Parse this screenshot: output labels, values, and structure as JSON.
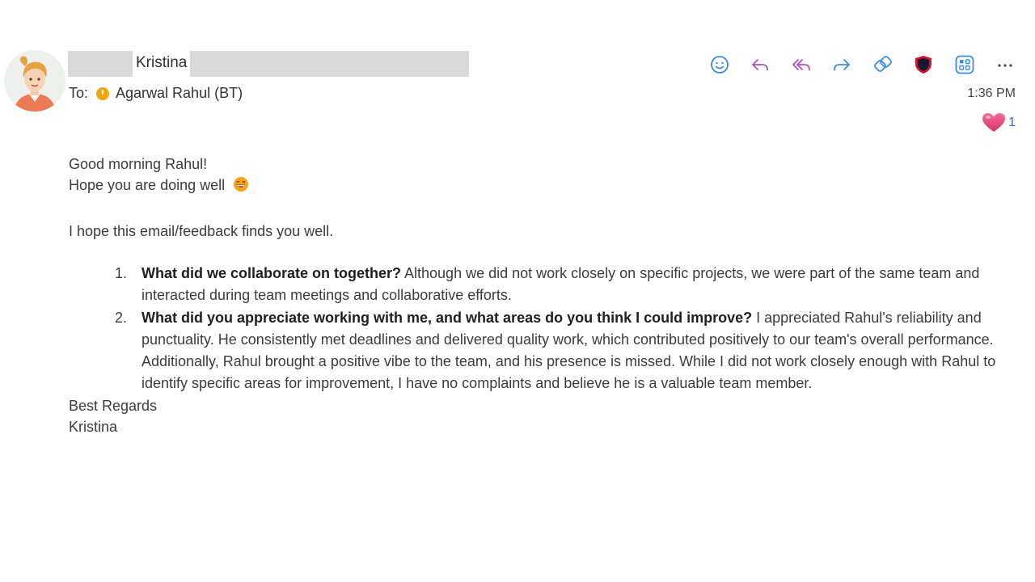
{
  "header": {
    "sender_name": "Kristina",
    "to_label": "To:",
    "recipient": "Agarwal Rahul (BT)",
    "time": "1:36 PM"
  },
  "toolbar": {
    "icons": [
      "emoji-icon",
      "reply-icon",
      "reply-all-icon",
      "forward-icon",
      "link-icon",
      "shield-icon",
      "apps-icon",
      "more-icon"
    ],
    "more_label": "···"
  },
  "reaction": {
    "icon": "heart-icon",
    "count": "1"
  },
  "email": {
    "greeting": "Good morning Rahul!",
    "line2": "Hope you are doing well",
    "intro": "I hope this email/feedback finds you well.",
    "items": [
      {
        "number": "1.",
        "question": "What did we collaborate on together?",
        "answer": " Although we did not work closely on specific projects, we were part of the same team and interacted during team meetings and collaborative efforts."
      },
      {
        "number": "2.",
        "question": "What did you appreciate working with me, and what areas do you think I could improve?",
        "answer": " I appreciated Rahul's reliability and punctuality. He consistently met deadlines and delivered quality work, which contributed positively to our team's overall performance. Additionally, Rahul brought a positive vibe to the team, and his presence is missed. While I did not work closely enough with Rahul to identify specific areas for improvement, I have no complaints and believe he is a valuable team member."
      }
    ],
    "closing": "Best Regards",
    "signature": "Kristina"
  },
  "colors": {
    "icon_blue": "#3b8de3",
    "icon_purple": "#b24fc4",
    "status_dot": "#f1a611",
    "heart": "#e8457a",
    "redaction": "#d9d9d9"
  }
}
